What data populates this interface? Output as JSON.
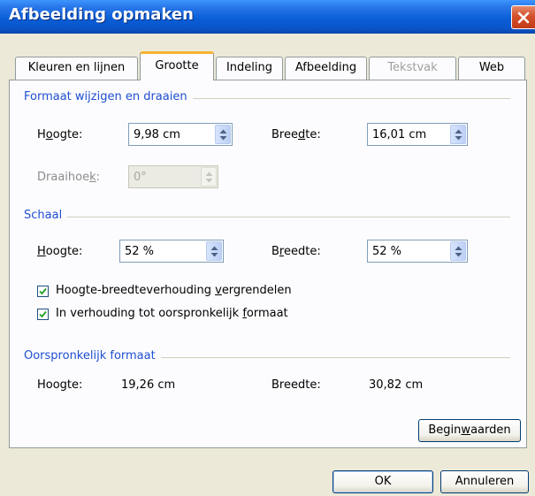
{
  "window": {
    "title": "Afbeelding opmaken"
  },
  "tabs": [
    {
      "label": "Kleuren en lijnen",
      "state": "normal"
    },
    {
      "label": "Grootte",
      "state": "active"
    },
    {
      "label": "Indeling",
      "state": "normal"
    },
    {
      "label": "Afbeelding",
      "state": "normal"
    },
    {
      "label": "Tekstvak",
      "state": "disabled"
    },
    {
      "label": "Web",
      "state": "normal"
    }
  ],
  "size_rotate": {
    "heading": "Formaat wijzigen en draaien",
    "height_label": "Hoogte:",
    "height_value": "9,98 cm",
    "width_label": "Breedte:",
    "width_value": "16,01 cm",
    "rotation_label": "Draaihoek:",
    "rotation_value": "0°"
  },
  "scale": {
    "heading": "Schaal",
    "height_label": "Hoogte:",
    "height_value": "52 %",
    "width_label": "Breedte:",
    "width_value": "52 %",
    "lock_aspect_label": "Hoogte-breedteverhouding vergrendelen",
    "lock_aspect_checked": true,
    "relative_label": "In verhouding tot oorspronkelijk formaat",
    "relative_checked": true
  },
  "original": {
    "heading": "Oorspronkelijk formaat",
    "height_label": "Hoogte:",
    "height_value": "19,26 cm",
    "width_label": "Breedte:",
    "width_value": "30,82 cm"
  },
  "buttons": {
    "reset": "Beginwaarden",
    "ok": "OK",
    "cancel": "Annuleren"
  },
  "colors": {
    "titlebar": "#0a5fd8",
    "dialog_face": "#ece9d8",
    "section_heading": "#1f4fd1",
    "active_tab_accent": "#f7b233"
  }
}
